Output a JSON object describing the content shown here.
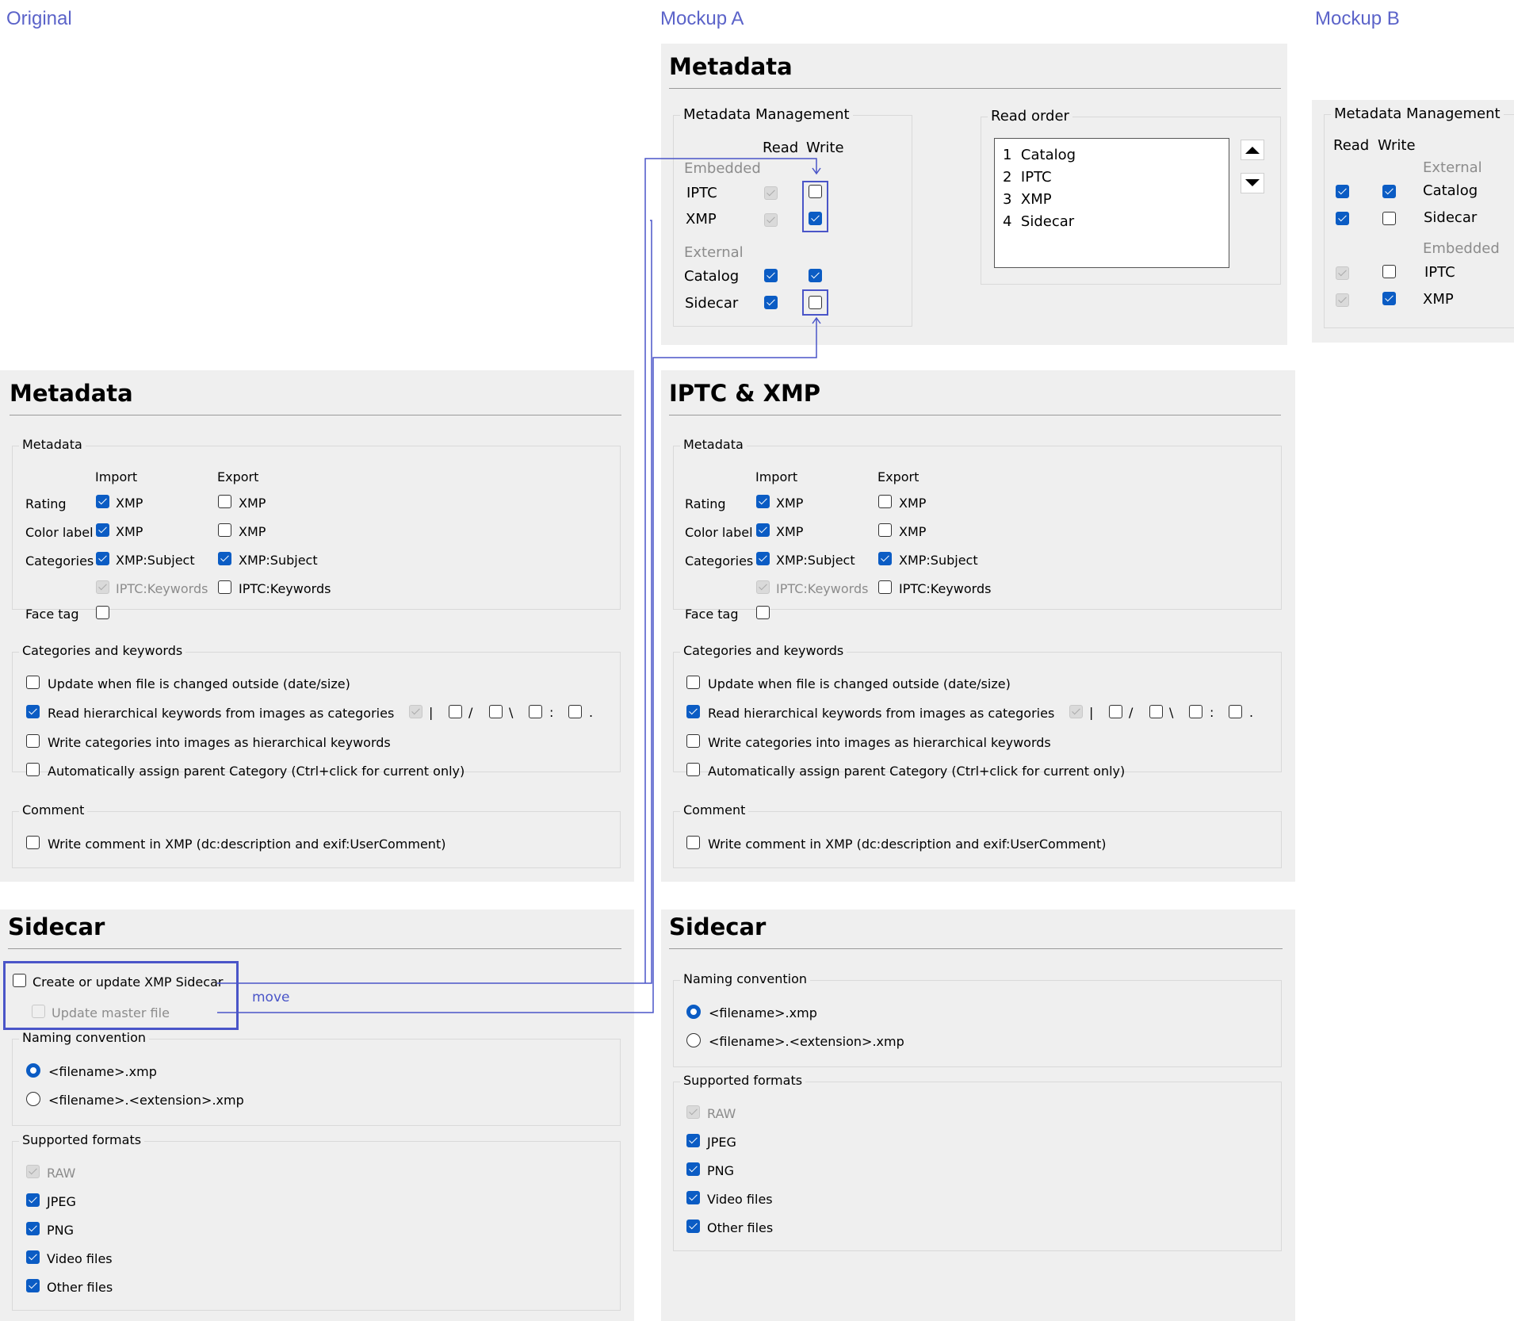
{
  "columns": {
    "original": "Original",
    "mockup_a": "Mockup A",
    "mockup_b": "Mockup B"
  },
  "mockup_a_top": {
    "title": "Metadata",
    "mgmt_group": "Metadata Management",
    "read_header": "Read",
    "write_header": "Write",
    "embedded_label": "Embedded",
    "external_label": "External",
    "rows": [
      {
        "label": "IPTC",
        "read": "disabled",
        "write": false
      },
      {
        "label": "XMP",
        "read": "disabled",
        "write": true
      },
      {
        "label": "Catalog",
        "read": true,
        "write": true
      },
      {
        "label": "Sidecar",
        "read": true,
        "write": false
      }
    ],
    "read_order_group": "Read order",
    "read_order": [
      {
        "num": "1",
        "name": "Catalog"
      },
      {
        "num": "2",
        "name": "IPTC"
      },
      {
        "num": "3",
        "name": "XMP"
      },
      {
        "num": "4",
        "name": "Sidecar"
      }
    ]
  },
  "mockup_b": {
    "mgmt_group": "Metadata Management",
    "read_header": "Read",
    "write_header": "Write",
    "external_label": "External",
    "embedded_label": "Embedded",
    "rows": [
      {
        "label": "Catalog",
        "read": true,
        "write": true
      },
      {
        "label": "Sidecar",
        "read": true,
        "write": false
      },
      {
        "label": "IPTC",
        "read": "disabled",
        "write": false
      },
      {
        "label": "XMP",
        "read": "disabled",
        "write": true
      }
    ]
  },
  "metadata_panel": {
    "original_title": "Metadata",
    "mockup_title": "IPTC  & XMP",
    "group_metadata": "Metadata",
    "import_header": "Import",
    "export_header": "Export",
    "rating_label": "Rating",
    "color_label": "Color label",
    "categories_label": "Categories",
    "face_tag_label": "Face tag",
    "xmp": "XMP",
    "xmp_subject": "XMP:Subject",
    "iptc_keywords": "IPTC:Keywords",
    "group_categories": "Categories and keywords",
    "update_outside": "Update when file is changed outside (date/size)",
    "read_hierarchical": "Read hierarchical keywords from images as categories",
    "sep_pipe": "|",
    "sep_slash": "/",
    "sep_backslash": "\\",
    "sep_colon": ":",
    "sep_dot": ".",
    "write_categories": "Write categories into images as hierarchical keywords",
    "auto_assign": "Automatically assign parent Category (Ctrl+click for current only)",
    "group_comment": "Comment",
    "write_comment": "Write comment in XMP (dc:description and exif:UserComment)"
  },
  "sidecar_panel": {
    "title": "Sidecar",
    "create_update": "Create or update XMP Sidecar",
    "update_master": "Update master file",
    "move_note": "move",
    "group_naming": "Naming convention",
    "naming_1": "<filename>.xmp",
    "naming_2": "<filename>.<extension>.xmp",
    "group_formats": "Supported formats",
    "formats": [
      "RAW",
      "JPEG",
      "PNG",
      "Video files",
      "Other files"
    ]
  },
  "colors": {
    "accent": "#0b5cc4",
    "annotation": "#4a55c8",
    "panel": "#efefef"
  }
}
